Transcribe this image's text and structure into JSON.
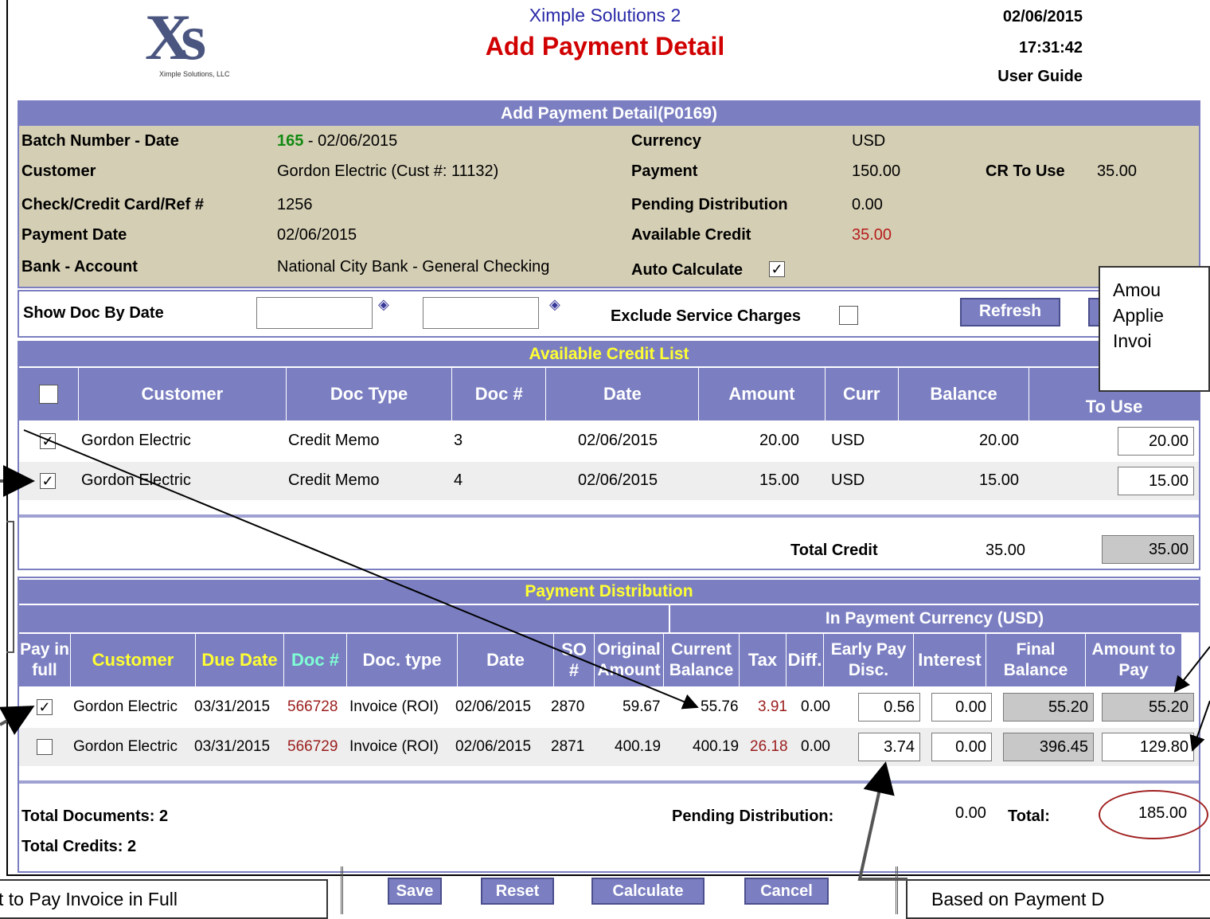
{
  "header": {
    "logo_text": "Xs",
    "logo_small": "Ximple Solutions, LLC",
    "app_title": "Ximple Solutions 2",
    "page_title": "Add Payment Detail",
    "date": "02/06/2015",
    "time": "17:31:42",
    "user_guide": "User Guide"
  },
  "info": {
    "bar": "Add Payment Detail(P0169)",
    "batch_label": "Batch Number - Date",
    "batch_num": "165",
    "batch_date": " - 02/06/2015",
    "customer_label": "Customer",
    "customer": "Gordon Electric (Cust #: 11132)",
    "check_label": "Check/Credit Card/Ref #",
    "check": "1256",
    "paydate_label": "Payment Date",
    "paydate": "02/06/2015",
    "bank_label": "Bank - Account",
    "bank": "National City Bank - General Checking",
    "currency_label": "Currency",
    "currency": "USD",
    "payment_label": "Payment",
    "payment": "150.00",
    "pending_label": "Pending Distribution",
    "pending": "0.00",
    "avail_label": "Available Credit",
    "avail": "35.00",
    "auto_label": "Auto Calculate",
    "cr_label": "CR To Use",
    "cr": "35.00"
  },
  "filter": {
    "label": "Show Doc By Date",
    "exclude_label": "Exclude Service Charges",
    "refresh": "Refresh"
  },
  "credit": {
    "bar": "Available Credit List",
    "headers": [
      "Customer",
      "Doc Type",
      "Doc #",
      "Date",
      "Amount",
      "Curr",
      "Balance",
      "To Use"
    ],
    "rows": [
      {
        "customer": "Gordon Electric",
        "doctype": "Credit Memo",
        "doc": "3",
        "date": "02/06/2015",
        "amount": "20.00",
        "curr": "USD",
        "balance": "20.00",
        "touse": "20.00"
      },
      {
        "customer": "Gordon Electric",
        "doctype": "Credit Memo",
        "doc": "4",
        "date": "02/06/2015",
        "amount": "15.00",
        "curr": "USD",
        "balance": "15.00",
        "touse": "15.00"
      }
    ],
    "total_label": "Total Credit",
    "total": "35.00",
    "total_box": "35.00"
  },
  "dist": {
    "bar": "Payment Distribution",
    "currency_bar": "In Payment Currency (USD)",
    "headers": {
      "pay": "Pay in full",
      "customer": "Customer",
      "due": "Due Date",
      "doc": "Doc #",
      "doctype": "Doc. type",
      "date": "Date",
      "so": "SO #",
      "orig": "Original Amount",
      "curbal": "Current Balance",
      "tax": "Tax",
      "diff": "Diff.",
      "early": "Early Pay Disc.",
      "interest": "Interest",
      "final": "Final Balance",
      "topay": "Amount to Pay"
    },
    "rows": [
      {
        "customer": "Gordon Electric",
        "due": "03/31/2015",
        "doc": "566728",
        "doctype": "Invoice (ROI)",
        "date": "02/06/2015",
        "so": "2870",
        "orig": "59.67",
        "curbal": "55.76",
        "tax": "3.91",
        "diff": "0.00",
        "early": "0.56",
        "interest": "0.00",
        "final": "55.20",
        "topay": "55.20"
      },
      {
        "customer": "Gordon Electric",
        "due": "03/31/2015",
        "doc": "566729",
        "doctype": "Invoice (ROI)",
        "date": "02/06/2015",
        "so": "2871",
        "orig": "400.19",
        "curbal": "400.19",
        "tax": "26.18",
        "diff": "0.00",
        "early": "3.74",
        "interest": "0.00",
        "final": "396.45",
        "topay": "129.80"
      }
    ],
    "total_docs": "Total Documents: 2",
    "total_credits": "Total Credits: 2",
    "pending_label": "Pending Distribution:",
    "pending": "0.00",
    "total_label": "Total:",
    "total": "185.00"
  },
  "buttons": {
    "save": "Save",
    "reset": "Reset",
    "calculate": "Calculate",
    "cancel": "Cancel"
  },
  "callouts": {
    "top_right": "Amou\nApplie\nInvoi",
    "bottom_left": "t to Pay Invoice in Full",
    "bottom_right": "Based on Payment D"
  },
  "check_mark": "✓"
}
